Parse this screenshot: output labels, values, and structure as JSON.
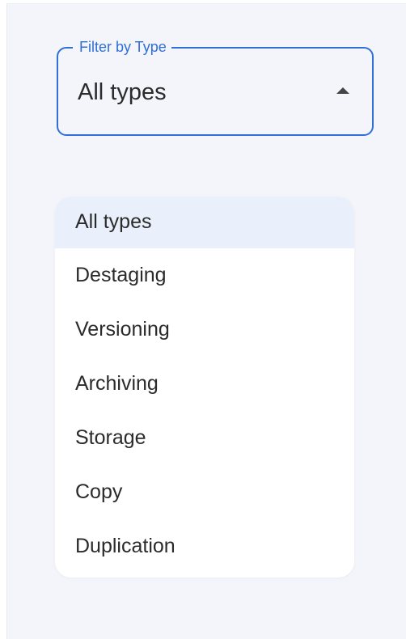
{
  "filter": {
    "label": "Filter by Type",
    "value": "All types",
    "accent_color": "#2f6fd6",
    "caret_icon": "caret-up-icon"
  },
  "menu": {
    "selected": "All types",
    "items": [
      {
        "label": "All types"
      },
      {
        "label": "Destaging"
      },
      {
        "label": "Versioning"
      },
      {
        "label": "Archiving"
      },
      {
        "label": "Storage"
      },
      {
        "label": "Copy"
      },
      {
        "label": "Duplication"
      }
    ]
  }
}
